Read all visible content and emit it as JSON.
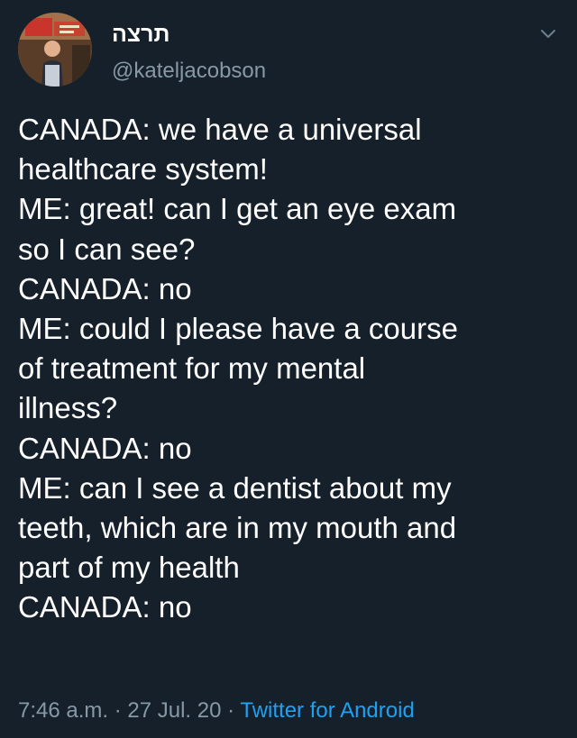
{
  "colors": {
    "background": "#15202b",
    "text_primary": "#ffffff",
    "text_secondary": "#8899a6",
    "link": "#1da1f2"
  },
  "tweet": {
    "author": {
      "display_name": "תרצה",
      "username": "@kateljacobson",
      "avatar_icon": "avatar-photo"
    },
    "menu_icon": "chevron-down-icon",
    "lines": [
      "CANADA: we have a universal",
      "healthcare system!",
      "ME: great! can I get an eye exam",
      "so I can see?",
      "CANADA: no",
      "ME: could I please have a course",
      "of treatment for my mental",
      "illness?",
      "CANADA: no",
      "ME: can I see a dentist about my",
      "teeth, which are in my mouth and",
      "part of my health",
      "CANADA: no"
    ],
    "timestamp": "7:46 a.m. · 27 Jul. 20",
    "separator": " · ",
    "source": "Twitter for Android"
  }
}
